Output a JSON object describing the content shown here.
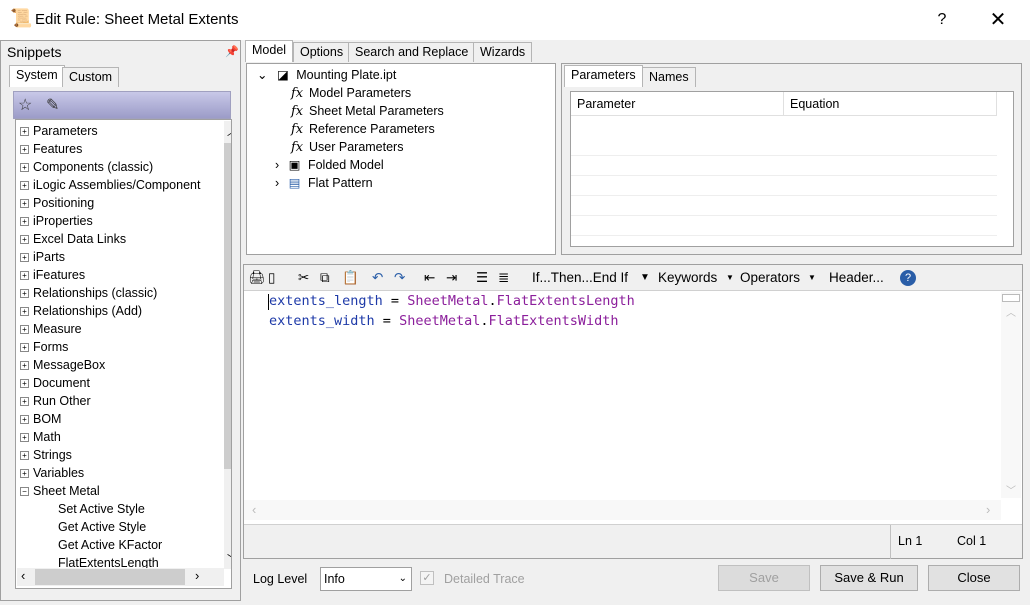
{
  "window": {
    "title": "Edit Rule: Sheet Metal Extents",
    "help_label": "?",
    "close_label": "✕"
  },
  "snippets": {
    "title": "Snippets",
    "tabs": [
      "System",
      "Custom"
    ],
    "items": [
      "Parameters",
      "Features",
      "Components (classic)",
      "iLogic Assemblies/Component",
      "Positioning",
      "iProperties",
      "Excel Data Links",
      "iParts",
      "iFeatures",
      "Relationships (classic)",
      "Relationships (Add)",
      "Measure",
      "Forms",
      "MessageBox",
      "Document",
      "Run Other",
      "BOM",
      "Math",
      "Strings",
      "Variables",
      "Sheet Metal"
    ],
    "sheet_metal_children": [
      "Set Active Style",
      "Get Active Style",
      "Get Active KFactor",
      "FlatExtentsLength"
    ]
  },
  "main_tabs": [
    "Model",
    "Options",
    "Search and Replace",
    "Wizards"
  ],
  "model_tree": {
    "root": "Mounting Plate.ipt",
    "params": [
      "Model Parameters",
      "Sheet Metal Parameters",
      "Reference Parameters",
      "User Parameters"
    ],
    "nodes": [
      "Folded Model",
      "Flat Pattern"
    ]
  },
  "params_panel": {
    "tabs": [
      "Parameters",
      "Names"
    ],
    "columns": [
      "Parameter",
      "Equation"
    ]
  },
  "editor_toolbar": {
    "if_then": "If...Then...End If",
    "keywords": "Keywords",
    "operators": "Operators",
    "header": "Header..."
  },
  "code": {
    "line1": {
      "var": "extents_length",
      "op": " = ",
      "obj": "SheetMetal",
      "dot": ".",
      "prop": "FlatExtentsLength"
    },
    "line2": {
      "var": "extents_width",
      "op": " = ",
      "obj": "SheetMetal",
      "dot": ".",
      "prop": "FlatExtentsWidth"
    }
  },
  "status": {
    "ln": "Ln 1",
    "col": "Col 1"
  },
  "footer": {
    "log_level_label": "Log Level",
    "log_level_value": "Info",
    "detailed_trace": "Detailed Trace",
    "save": "Save",
    "save_run": "Save & Run",
    "close": "Close"
  }
}
